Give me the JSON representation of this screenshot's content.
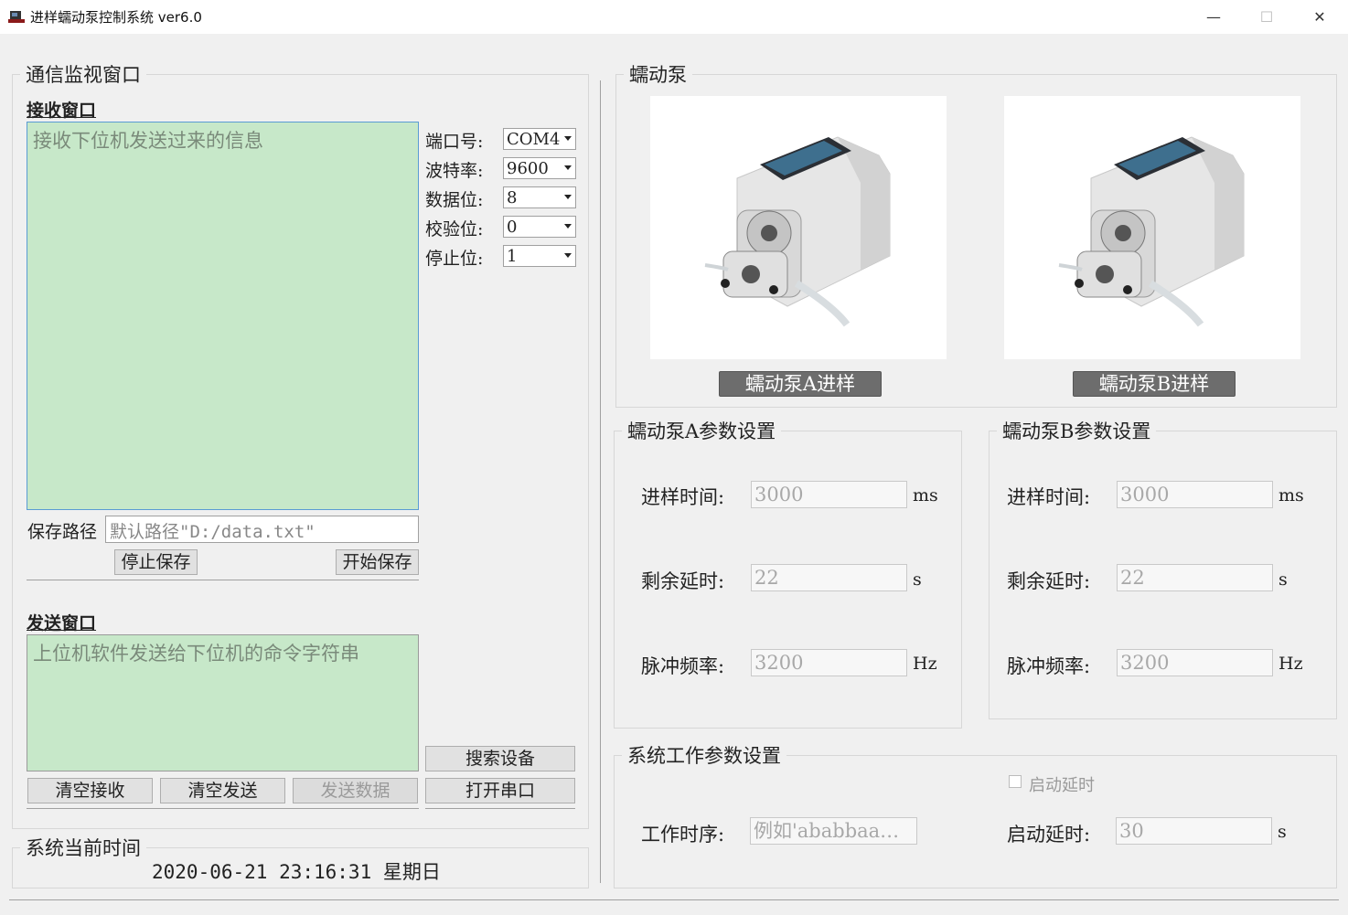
{
  "window": {
    "title": "进样蠕动泵控制系统 ver6.0",
    "min": "—",
    "max": "☐",
    "close": "✕"
  },
  "comm": {
    "group_title": "通信监视窗口",
    "recv_title": "接收窗口",
    "recv_placeholder": "接收下位机发送过来的信息",
    "save_path_label": "保存路径",
    "save_path_placeholder": "默认路径\"D:/data.txt\"",
    "stop_save": "停止保存",
    "start_save": "开始保存",
    "send_title": "发送窗口",
    "send_placeholder": "上位机软件发送给下位机的命令字符串",
    "clear_recv": "清空接收",
    "clear_send": "清空发送",
    "send_data": "发送数据",
    "search_device": "搜索设备",
    "open_port": "打开串口",
    "port_label": "端口号:",
    "port_value": "COM4",
    "baud_label": "波特率:",
    "baud_value": "9600",
    "data_label": "数据位:",
    "data_value": "8",
    "parity_label": "校验位:",
    "parity_value": "0",
    "stop_label": "停止位:",
    "stop_value": "1"
  },
  "clock": {
    "group_title": "系统当前时间",
    "value": "2020-06-21  23:16:31  星期日"
  },
  "pump": {
    "group_title": "蠕动泵",
    "btn_a": "蠕动泵A进样",
    "btn_b": "蠕动泵B进样"
  },
  "paramA": {
    "group_title": "蠕动泵A参数设置",
    "time_label": "进样时间:",
    "time_value": "3000",
    "time_unit": "ms",
    "delay_label": "剩余延时:",
    "delay_value": "22",
    "delay_unit": "s",
    "freq_label": "脉冲频率:",
    "freq_value": "3200",
    "freq_unit": "Hz"
  },
  "paramB": {
    "group_title": "蠕动泵B参数设置",
    "time_label": "进样时间:",
    "time_value": "3000",
    "time_unit": "ms",
    "delay_label": "剩余延时:",
    "delay_value": "22",
    "delay_unit": "s",
    "freq_label": "脉冲频率:",
    "freq_value": "3200",
    "freq_unit": "Hz"
  },
  "system": {
    "group_title": "系统工作参数设置",
    "startup_delay_check": "启动延时",
    "seq_label": "工作时序:",
    "seq_placeholder": "例如'ababbaa…",
    "start_delay_label": "启动延时:",
    "start_delay_value": "30",
    "start_delay_unit": "s"
  }
}
